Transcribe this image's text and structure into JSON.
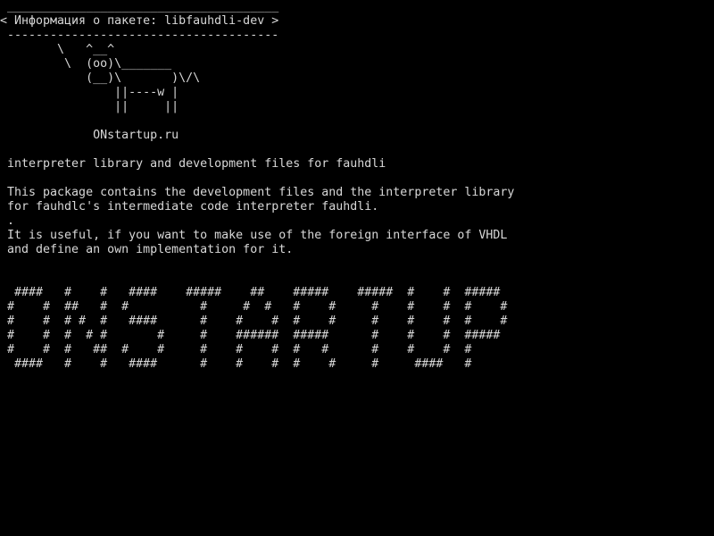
{
  "terminal": {
    "background": "#000000",
    "foreground": "#d8d8d8",
    "lines": [
      " ______________________________________",
      "< Информация о пакете: libfauhdli-dev >",
      " --------------------------------------",
      "        \\   ^__^",
      "         \\  (oo)\\_______",
      "            (__)\\       )\\/\\",
      "                ||----w |",
      "                ||     ||",
      "",
      "             ONstartup.ru",
      "",
      " interpreter library and development files for fauhdli",
      "",
      " This package contains the development files and the interpreter library",
      " for fauhdlc's intermediate code interpreter fauhdli.",
      " .",
      " It is useful, if you want to make use of the foreign interface of VHDL",
      " and define an own implementation for it.",
      "",
      "",
      "  ####   #    #   ####    #####    ##    #####    #####  #    #  #####",
      " #    #  ##   #  #          #     #  #   #    #     #    #    #  #    #",
      " #    #  # #  #   ####      #    #    #  #    #     #    #    #  #    #",
      " #    #  #  # #       #     #    ######  #####      #    #    #  #####",
      " #    #  #   ##  #    #     #    #    #  #   #      #    #    #  #",
      "  ####   #    #   ####      #    #    #  #    #     #     ####   #"
    ]
  }
}
